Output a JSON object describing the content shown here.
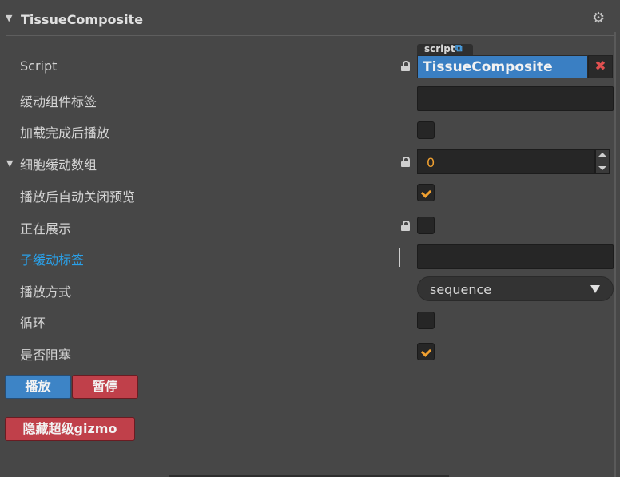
{
  "component": {
    "title": "TissueComposite"
  },
  "script_row": {
    "label": "Script",
    "tag": "script",
    "value": "TissueComposite",
    "clear_symbol": "✖"
  },
  "rows": {
    "tween_label": "缓动组件标签",
    "play_on_load": {
      "label": "加载完成后播放",
      "checked": false
    },
    "cell_array": {
      "label": "细胞缓动数组",
      "value": "0"
    },
    "auto_close_preview": {
      "label": "播放后自动关闭预览",
      "checked": true
    },
    "showing": {
      "label": "正在展示",
      "checked": false
    },
    "sub_tween_label": "子缓动标签",
    "play_mode": {
      "label": "播放方式",
      "value": "sequence"
    },
    "loop": {
      "label": "循环",
      "checked": false
    },
    "blocking": {
      "label": "是否阻塞",
      "checked": true
    }
  },
  "buttons": {
    "play": "播放",
    "pause": "暂停",
    "hide_gizmo": "隐藏超级gizmo"
  },
  "icons": {
    "settings": "gear-icon",
    "external_link": "external-link-icon",
    "lock": "lock-icon"
  },
  "colors": {
    "accent_blue": "#3d84c6",
    "danger_red": "#c0404a",
    "check_orange": "#f0a030",
    "link_blue": "#2aa0e8"
  }
}
